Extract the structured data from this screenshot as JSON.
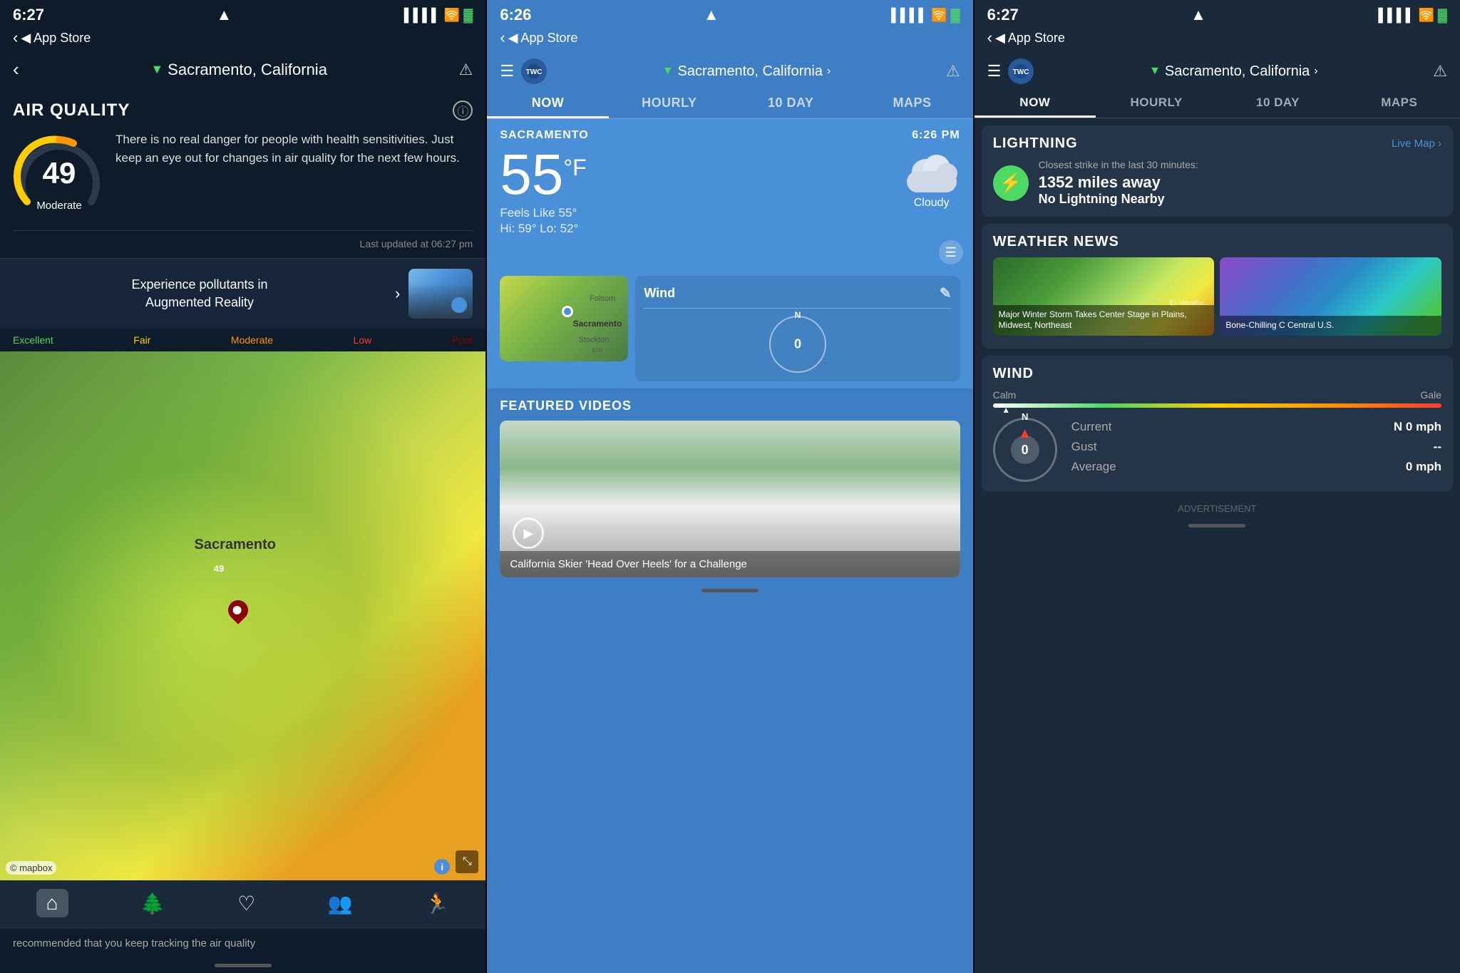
{
  "panel1": {
    "status": {
      "time": "6:27",
      "location_icon": "▲",
      "back_store": "◀ App Store"
    },
    "nav": {
      "back": "‹",
      "location": "Sacramento, California",
      "warning": "⚠"
    },
    "air_quality": {
      "title": "AIR QUALITY",
      "number": "49",
      "label": "Moderate",
      "description": "There is no real danger for people with health sensitivities. Just keep an eye out for changes in air quality for the next few hours.",
      "last_updated": "Last updated at 06:27 pm"
    },
    "ar_banner": {
      "text": "Experience pollutants in\nAugmented Reality",
      "chevron": "›"
    },
    "legend": {
      "excellent": "Excellent",
      "fair": "Fair",
      "moderate": "Moderate",
      "low": "Low",
      "poor": "Poor"
    },
    "map": {
      "label": "Sacramento",
      "pin_value": "49"
    },
    "bottom_nav": {
      "home": "⌂",
      "nature": "🌲",
      "health": "♡",
      "people": "👥",
      "running": "🏃"
    },
    "scroll_hint": "recommended that you keep tracking the air quality"
  },
  "panel2": {
    "status": {
      "time": "6:26"
    },
    "nav": {
      "location": "Sacramento, California",
      "chevron": "›"
    },
    "tabs": [
      "NOW",
      "HOURLY",
      "10 DAY",
      "MAPS"
    ],
    "active_tab": "NOW",
    "weather": {
      "city": "SACRAMENTO",
      "time": "6:26 PM",
      "temp": "55",
      "unit": "°F",
      "feels_like": "Feels Like 55°",
      "hi_lo": "Hi: 59° Lo: 52°",
      "condition": "Cloudy"
    },
    "wind": {
      "title": "Wind",
      "value": "0"
    },
    "featured_videos": {
      "title": "FEATURED VIDEOS",
      "caption": "California Skier 'Head Over Heels' for a Challenge"
    }
  },
  "panel3": {
    "status": {
      "time": "6:27"
    },
    "nav": {
      "location": "Sacramento, California",
      "chevron": "›"
    },
    "tabs": [
      "NOW",
      "HOURLY",
      "10 DAY",
      "MAPS"
    ],
    "active_tab": "NOW",
    "lightning": {
      "title": "LIGHTNING",
      "live_map": "Live Map ›",
      "closest_label": "Closest strike in the last 30 minutes:",
      "distance": "1352 miles away",
      "status": "No Lightning Nearby"
    },
    "weather_news": {
      "title": "WEATHER NEWS",
      "story1": "Major Winter Storm Takes Center Stage in Plains, Midwest, Northeast",
      "story2": "Bone-Chilling C Central U.S."
    },
    "wind": {
      "title": "WIND",
      "calm": "Calm",
      "gale": "Gale",
      "current_label": "Current",
      "current_value": "N 0 mph",
      "gust_label": "Gust",
      "gust_value": "--",
      "average_label": "Average",
      "average_value": "0  mph",
      "compass_value": "0"
    },
    "advertisement": "ADVERTISEMENT"
  }
}
